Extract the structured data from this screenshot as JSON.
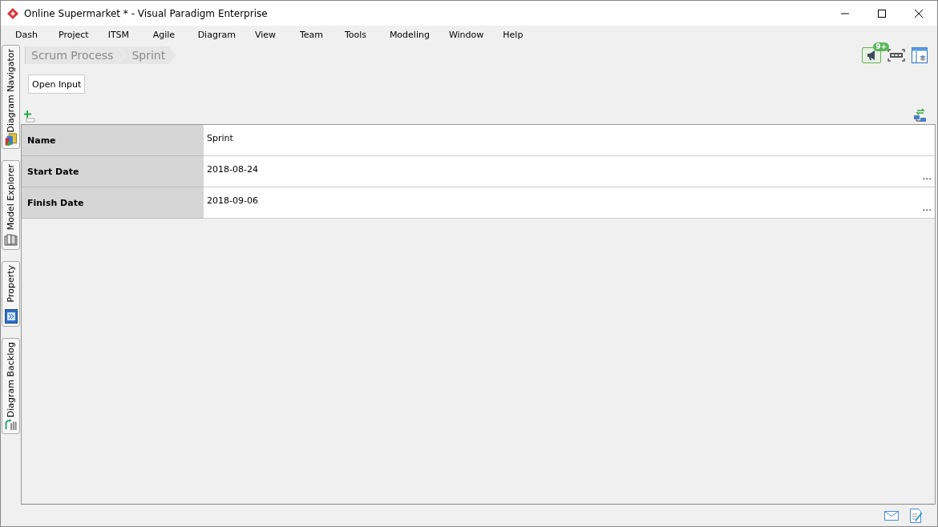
{
  "window": {
    "title": "Online Supermarket * - Visual Paradigm Enterprise"
  },
  "menu": [
    "Dash",
    "Project",
    "ITSM",
    "Agile",
    "Diagram",
    "View",
    "Team",
    "Tools",
    "Modeling",
    "Window",
    "Help"
  ],
  "side_tabs": [
    {
      "label": "Diagram Navigator"
    },
    {
      "label": "Model Explorer"
    },
    {
      "label": "Property"
    },
    {
      "label": "Diagram Backlog"
    }
  ],
  "breadcrumb": [
    "Scrum Process",
    "Sprint"
  ],
  "notification_badge": "9+",
  "open_input_button": "Open Input",
  "properties": [
    {
      "name": "Name",
      "value": "Sprint"
    },
    {
      "name": "Start Date",
      "value": "2018-08-24",
      "button": "..."
    },
    {
      "name": "Finish Date",
      "value": "2018-09-06",
      "button": "..."
    }
  ]
}
